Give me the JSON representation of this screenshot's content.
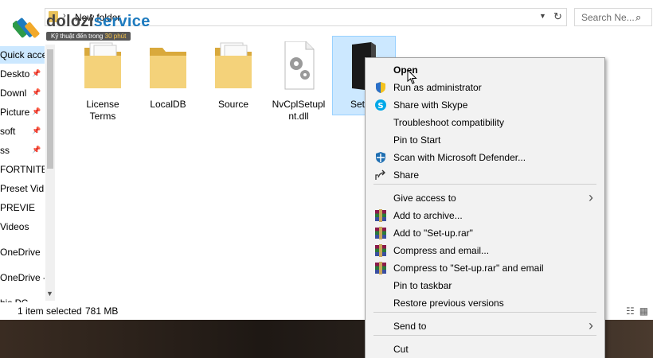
{
  "address_bar": {
    "path_segments": [
      "New folder"
    ],
    "separator": "›"
  },
  "search": {
    "placeholder": "Search Ne..."
  },
  "logo": {
    "name_part1": "dolozi",
    "name_part2": "service",
    "tagline_prefix": "Kỹ thuật đến trong",
    "tagline_highlight": "30 phút"
  },
  "nav": {
    "items": [
      {
        "label": "Quick acces",
        "selected": true,
        "pinned": false
      },
      {
        "label": "Deskto",
        "pinned": true
      },
      {
        "label": "Downl",
        "pinned": true
      },
      {
        "label": "Picture",
        "pinned": true
      },
      {
        "label": "soft",
        "pinned": true
      },
      {
        "label": "ss",
        "pinned": true
      },
      {
        "label": "FORTNITE",
        "pinned": false
      },
      {
        "label": "Preset Vid",
        "pinned": false
      },
      {
        "label": "PREVIE",
        "pinned": false
      },
      {
        "label": "Videos",
        "pinned": false
      },
      {
        "label": "OneDrive",
        "pinned": false
      },
      {
        "label": "OneDrive -",
        "pinned": false
      },
      {
        "label": "his PC",
        "pinned": false
      }
    ]
  },
  "files": [
    {
      "name_line1": "License",
      "name_line2": "Terms",
      "type": "folder-docs"
    },
    {
      "name_line1": "LocalDB",
      "name_line2": "",
      "type": "folder"
    },
    {
      "name_line1": "Source",
      "name_line2": "",
      "type": "folder-docs"
    },
    {
      "name_line1": "NvCplSetupl",
      "name_line2": "nt.dll",
      "type": "dll"
    },
    {
      "name_line1": "Set-",
      "name_line2": "",
      "type": "setup-exe"
    }
  ],
  "status_bar": {
    "selection": "1 item selected",
    "size": "781 MB"
  },
  "context_menu": {
    "items": [
      {
        "label": "Open",
        "bold": true,
        "icon": ""
      },
      {
        "label": "Run as administrator",
        "icon": "shield-icon"
      },
      {
        "label": "Share with Skype",
        "icon": "skype-icon"
      },
      {
        "label": "Troubleshoot compatibility",
        "icon": ""
      },
      {
        "label": "Pin to Start",
        "icon": ""
      },
      {
        "label": "Scan with Microsoft Defender...",
        "icon": "defender-icon"
      },
      {
        "label": "Share",
        "icon": "share-icon"
      },
      {
        "label": "Give access to",
        "icon": "",
        "submenu": true
      },
      {
        "label": "Add to archive...",
        "icon": "winrar-icon"
      },
      {
        "label": "Add to \"Set-up.rar\"",
        "icon": "winrar-icon"
      },
      {
        "label": "Compress and email...",
        "icon": "winrar-icon"
      },
      {
        "label": "Compress to \"Set-up.rar\" and email",
        "icon": "winrar-icon"
      },
      {
        "label": "Pin to taskbar",
        "icon": ""
      },
      {
        "label": "Restore previous versions",
        "icon": ""
      },
      {
        "label": "Send to",
        "icon": "",
        "submenu": true
      },
      {
        "label": "Cut",
        "icon": ""
      }
    ]
  },
  "colors": {
    "selection": "#cce8ff",
    "folder": "#e8c15a",
    "menu_bg": "#f2f2f2",
    "brand_blue": "#1e7bbf"
  }
}
